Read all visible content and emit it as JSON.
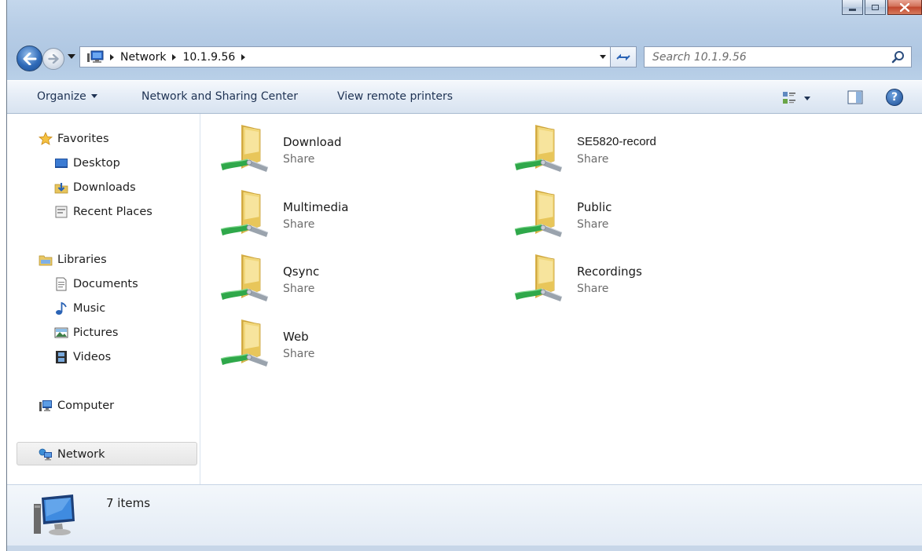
{
  "window": {
    "caption_buttons": [
      "minimize",
      "maximize",
      "close"
    ]
  },
  "address": {
    "crumbs": [
      "Network",
      "10.1.9.56"
    ]
  },
  "search": {
    "placeholder": "Search 10.1.9.56"
  },
  "toolbar": {
    "organize": "Organize",
    "network_sharing": "Network and Sharing Center",
    "view_printers": "View remote printers"
  },
  "sidebar": {
    "favorites": {
      "label": "Favorites",
      "items": [
        {
          "label": "Desktop",
          "icon": "desktop-icon"
        },
        {
          "label": "Downloads",
          "icon": "downloads-icon"
        },
        {
          "label": "Recent Places",
          "icon": "recent-places-icon"
        }
      ]
    },
    "libraries": {
      "label": "Libraries",
      "items": [
        {
          "label": "Documents",
          "icon": "documents-icon"
        },
        {
          "label": "Music",
          "icon": "music-icon"
        },
        {
          "label": "Pictures",
          "icon": "pictures-icon"
        },
        {
          "label": "Videos",
          "icon": "videos-icon"
        }
      ]
    },
    "computer": "Computer",
    "network": "Network"
  },
  "shares": [
    {
      "name": "Download",
      "type": "Share"
    },
    {
      "name": "SE5820-record",
      "type": "Share"
    },
    {
      "name": "Multimedia",
      "type": "Share"
    },
    {
      "name": "Public",
      "type": "Share"
    },
    {
      "name": "Qsync",
      "type": "Share"
    },
    {
      "name": "Recordings",
      "type": "Share"
    },
    {
      "name": "Web",
      "type": "Share"
    }
  ],
  "status": {
    "count": "7 items"
  },
  "colors": {
    "titlebar": "#b9d0e8",
    "cmdbar": "#e4ecf6",
    "folder": "#f1d77a",
    "share_pipe": "#2fa84a"
  }
}
